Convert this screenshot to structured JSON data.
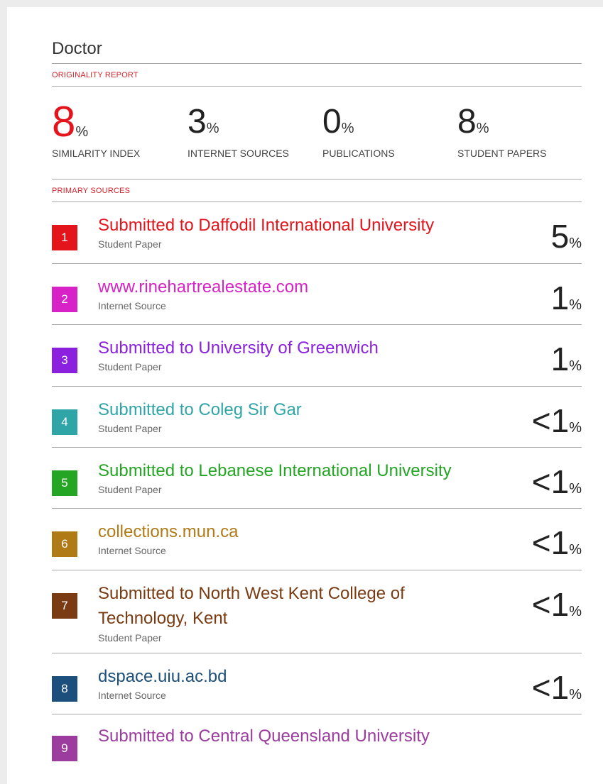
{
  "report": {
    "title": "Doctor",
    "originality_label": "ORIGINALITY REPORT",
    "primary_label": "PRIMARY SOURCES",
    "stats": [
      {
        "value": "8",
        "pct": "%",
        "label": "SIMILARITY INDEX"
      },
      {
        "value": "3",
        "pct": "%",
        "label": "INTERNET SOURCES"
      },
      {
        "value": "0",
        "pct": "%",
        "label": "PUBLICATIONS"
      },
      {
        "value": "8",
        "pct": "%",
        "label": "STUDENT PAPERS"
      }
    ],
    "sources": [
      {
        "num": "1",
        "name": "Submitted to Daffodil International University",
        "type": "Student Paper",
        "pct": "5",
        "color": "#e3141b"
      },
      {
        "num": "2",
        "name": "www.rinehartrealestate.com",
        "type": "Internet Source",
        "pct": "1",
        "color": "#d622c6"
      },
      {
        "num": "3",
        "name": "Submitted to University of Greenwich",
        "type": "Student Paper",
        "pct": "1",
        "color": "#8b21df"
      },
      {
        "num": "4",
        "name": "Submitted to Coleg Sir Gar",
        "type": "Student Paper",
        "pct": "<1",
        "color": "#2fa5a8"
      },
      {
        "num": "5",
        "name": "Submitted to Lebanese International University",
        "type": "Student Paper",
        "pct": "<1",
        "color": "#24a524"
      },
      {
        "num": "6",
        "name": "collections.mun.ca",
        "type": "Internet Source",
        "pct": "<1",
        "color": "#b07a16"
      },
      {
        "num": "7",
        "name": "Submitted to North West Kent College of",
        "name2": "Technology, Kent",
        "type": "Student Paper",
        "pct": "<1",
        "color": "#7a3b12"
      },
      {
        "num": "8",
        "name": "dspace.uiu.ac.bd",
        "type": "Internet Source",
        "pct": "<1",
        "color": "#1c4f7c"
      },
      {
        "num": "9",
        "name": "Submitted to Central Queensland University",
        "type": "",
        "pct": "",
        "color": "#9b3c9e"
      }
    ],
    "pct_symbol": "%"
  }
}
